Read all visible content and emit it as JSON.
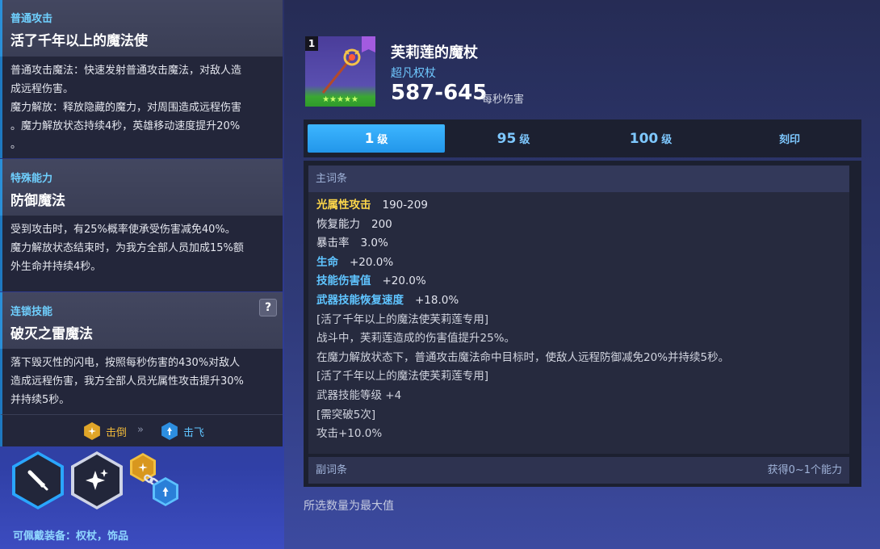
{
  "skills": {
    "normal": {
      "tag": "普通攻击",
      "title": "活了千年以上的魔法使",
      "lines": [
        "普通攻击魔法：快速发射普通攻击魔法，对敌人造",
        "成远程伤害。",
        "魔力解放：释放隐藏的魔力，对周围造成远程伤害",
        "。魔力解放状态持续4秒，英雄移动速度提升20%",
        "。"
      ]
    },
    "special": {
      "tag": "特殊能力",
      "title": "防御魔法",
      "lines": [
        "受到攻击时，有25%概率使承受伤害减免40%。",
        "魔力解放状态结束时，为我方全部人员加成15%额",
        "外生命并持续4秒。"
      ]
    },
    "chain": {
      "tag": "连锁技能",
      "title": "破灭之雷魔法",
      "help": "?",
      "lines": [
        "落下毁灭性的闪电，按照每秒伤害的430%对敌人",
        "造成远程伤害，我方全部人员光属性攻击提升30%",
        "并持续5秒。"
      ],
      "effect_from": "击倒",
      "effect_arrow": "»",
      "effect_to": "击飞"
    }
  },
  "equip_label": "可佩戴装备：权杖，饰品",
  "weapon": {
    "level_badge": "1",
    "stars": "★★★★★",
    "name": "芙莉莲的魔杖",
    "type": "超凡权杖",
    "dps": "587-645",
    "dps_unit": "每秒伤害"
  },
  "tabs": [
    {
      "num": "1",
      "unit": "级",
      "active": true
    },
    {
      "num": "95",
      "unit": "级",
      "active": false
    },
    {
      "num": "100",
      "unit": "级",
      "active": false
    },
    {
      "num": "",
      "unit": "刻印",
      "active": false
    }
  ],
  "main_stats": {
    "header": "主词条",
    "lines": [
      {
        "label": "光属性攻击",
        "value": "190-209"
      },
      {
        "label": "恢复能力",
        "value": "200"
      },
      {
        "label": "暴击率",
        "value": "3.0%"
      },
      {
        "label": "生命",
        "value": "+20.0%"
      },
      {
        "label": "技能伤害值",
        "value": "+20.0%"
      },
      {
        "label": "武器技能恢复速度",
        "value": "+18.0%"
      }
    ],
    "notes": [
      "[活了千年以上的魔法使芙莉莲专用]",
      "战斗中，芙莉莲造成的伤害值提升25%。",
      "在魔力解放状态下，普通攻击魔法命中目标时，使敌人远程防御减免20%并持续5秒。",
      "[活了千年以上的魔法使芙莉莲专用]",
      "武器技能等级  +4",
      "[需突破5次]",
      "攻击+10.0%"
    ]
  },
  "sub_stats": {
    "header": "副词条",
    "note": "获得0~1个能力"
  },
  "footer_note": "所选数量为最大值",
  "colors": {
    "accent_blue": "#2296ea",
    "stat_yellow": "#ffd84a",
    "stat_blue": "#5fc4ff",
    "tag_cyan": "#6fd0ff",
    "effect_gold": "#e0a528",
    "effect_blue": "#2d8ee0"
  },
  "icons": {
    "weapon": "staff-icon",
    "rarity": "rarity-badge-icon",
    "skill_1": "sword-icon",
    "skill_2": "sparkle-icon",
    "skill_chain_a": "knockdown-icon",
    "skill_chain_b": "airborne-icon",
    "chain_link": "chain-link-icon"
  }
}
